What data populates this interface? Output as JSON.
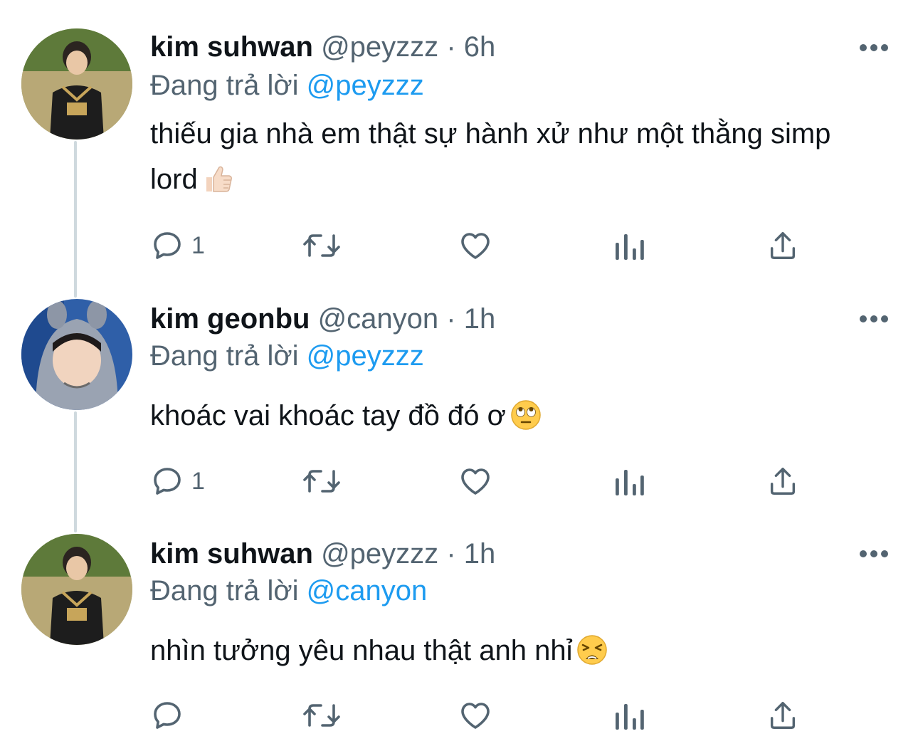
{
  "tweets": [
    {
      "name": "kim suhwan",
      "handle": "@peyzzz",
      "dot": "·",
      "time": "6h",
      "reply_prefix": "Đang trả lời",
      "reply_to": "@peyzzz",
      "text": "thiếu gia nhà em thật sự hành xử như một thằng simp lord",
      "emoji": "thumbs-up-emoji",
      "reply_count": "1",
      "avatar": "player-avatar-black-jersey"
    },
    {
      "name": "kim geonbu",
      "handle": "@canyon",
      "dot": "·",
      "time": "1h",
      "reply_prefix": "Đang trả lời",
      "reply_to": "@peyzzz",
      "text": "khoác vai khoác tay đồ đó ơ",
      "emoji": "eye-roll-emoji",
      "reply_count": "1",
      "avatar": "player-avatar-animal-hood"
    },
    {
      "name": "kim suhwan",
      "handle": "@peyzzz",
      "dot": "·",
      "time": "1h",
      "reply_prefix": "Đang trả lời",
      "reply_to": "@canyon",
      "text": "nhìn tưởng yêu nhau thật anh nhỉ",
      "emoji": "weary-face-emoji",
      "reply_count": "",
      "avatar": "player-avatar-black-jersey"
    }
  ],
  "icons": {
    "reply": "reply-icon",
    "retweet": "retweet-icon",
    "like": "like-icon",
    "views": "views-icon",
    "share": "share-icon",
    "more": "more-icon"
  },
  "colors": {
    "text": "#0f1419",
    "secondary": "#536471",
    "accent": "#1d9bf0",
    "thread_line": "#cfd9de"
  }
}
